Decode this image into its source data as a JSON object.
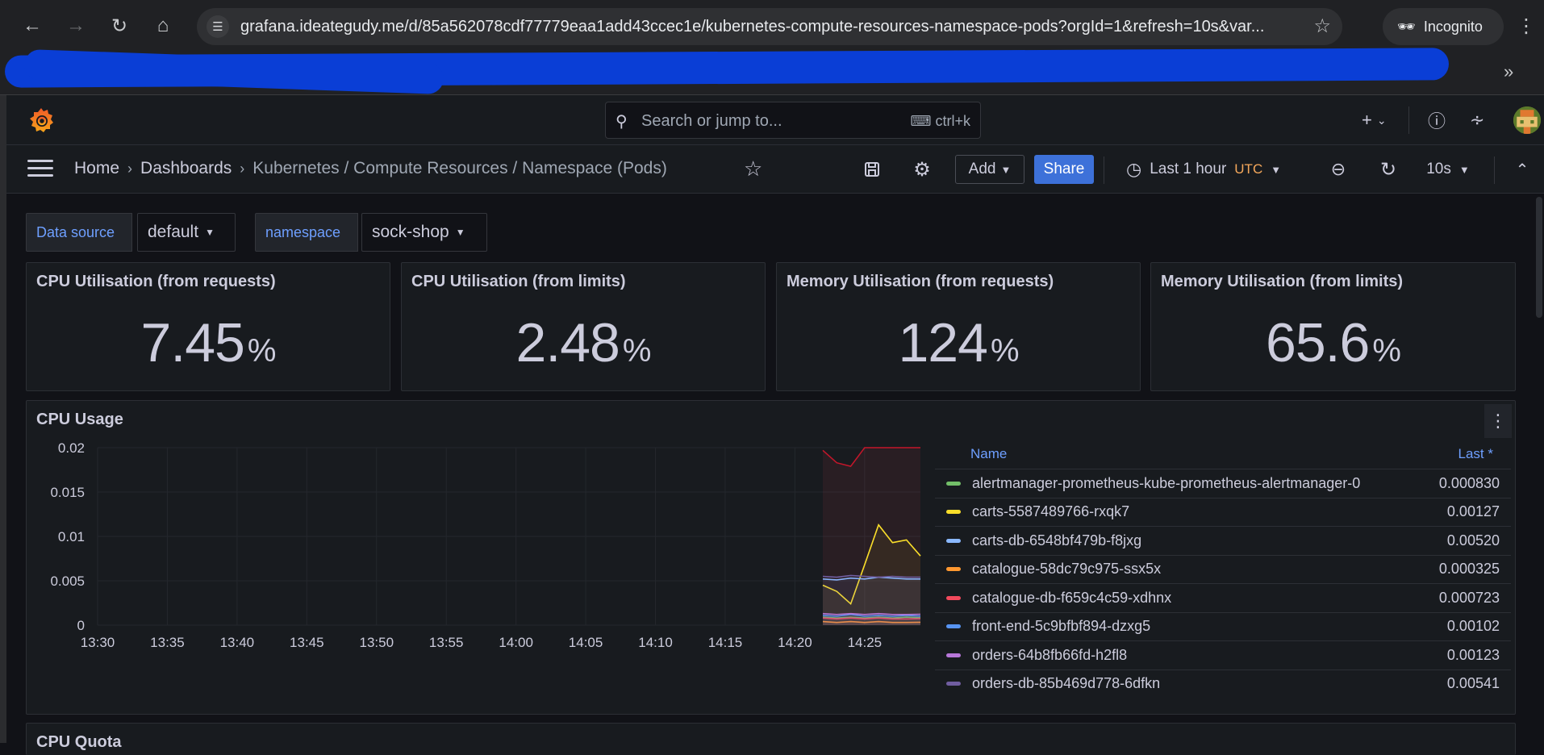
{
  "browser": {
    "url": "grafana.ideategudy.me/d/85a562078cdf77779eaa1add43ccec1e/kubernetes-compute-resources-namespace-pods?orgId=1&refresh=10s&var...",
    "incognito_label": "Incognito"
  },
  "topbar": {
    "search_placeholder": "Search or jump to...",
    "search_shortcut": "ctrl+k"
  },
  "breadcrumb": {
    "home": "Home",
    "dashboards": "Dashboards",
    "current": "Kubernetes / Compute Resources / Namespace (Pods)"
  },
  "toolbar": {
    "add_label": "Add",
    "share_label": "Share",
    "time_range": "Last 1 hour",
    "timezone": "UTC",
    "refresh_interval": "10s"
  },
  "variables": {
    "datasource_label": "Data source",
    "datasource_value": "default",
    "namespace_label": "namespace",
    "namespace_value": "sock-shop"
  },
  "stats": [
    {
      "title": "CPU Utilisation (from requests)",
      "value": "7.45",
      "unit": "%"
    },
    {
      "title": "CPU Utilisation (from limits)",
      "value": "2.48",
      "unit": "%"
    },
    {
      "title": "Memory Utilisation (from requests)",
      "value": "124",
      "unit": "%"
    },
    {
      "title": "Memory Utilisation (from limits)",
      "value": "65.6",
      "unit": "%"
    }
  ],
  "cpu_panel": {
    "title": "CPU Usage",
    "legend_name_header": "Name",
    "legend_last_header": "Last *"
  },
  "next_panel_title": "CPU Quota",
  "colors": {
    "accent": "#3d71d9",
    "link": "#6e9fff",
    "utc": "#f5a85b"
  },
  "chart_data": {
    "type": "line",
    "title": "CPU Usage",
    "xlabel": "",
    "ylabel": "",
    "y_ticks": [
      "0.02",
      "0.015",
      "0.01",
      "0.005",
      "0"
    ],
    "x_ticks": [
      "13:30",
      "13:35",
      "13:40",
      "13:45",
      "13:50",
      "13:55",
      "14:00",
      "14:05",
      "14:10",
      "14:15",
      "14:20",
      "14:25"
    ],
    "ylim": [
      0,
      0.02
    ],
    "xlim": [
      "13:30",
      "14:29"
    ],
    "grid": true,
    "legend_position": "right",
    "x": [
      "14:22",
      "14:23",
      "14:24",
      "14:25",
      "14:26",
      "14:27",
      "14:28",
      "14:29"
    ],
    "series": [
      {
        "name": "alertmanager-prometheus-kube-prometheus-alertmanager-0",
        "color": "#73bf69",
        "last": "0.000830",
        "values": [
          0.0009,
          0.0008,
          0.0009,
          0.0008,
          0.0009,
          0.0008,
          0.0009,
          0.00083
        ]
      },
      {
        "name": "carts-5587489766-rxqk7",
        "color": "#fade2a",
        "last": "0.00127",
        "values": [
          0.0045,
          0.0038,
          0.0024,
          0.0068,
          0.0113,
          0.0093,
          0.0096,
          0.0078
        ]
      },
      {
        "name": "carts-db-6548bf479b-f8jxg",
        "color": "#8ab8ff",
        "last": "0.00520",
        "values": [
          0.0052,
          0.0051,
          0.0053,
          0.0052,
          0.0054,
          0.0053,
          0.0052,
          0.0052
        ]
      },
      {
        "name": "catalogue-58dc79c975-ssx5x",
        "color": "#ff9830",
        "last": "0.000325",
        "values": [
          0.0004,
          0.0003,
          0.0004,
          0.0003,
          0.0004,
          0.0003,
          0.0003,
          0.000325
        ]
      },
      {
        "name": "catalogue-db-f659c4c59-xdhnx",
        "color": "#f2495c",
        "last": "0.000723",
        "values": [
          0.0008,
          0.0007,
          0.0008,
          0.0007,
          0.0008,
          0.0007,
          0.0007,
          0.000723
        ]
      },
      {
        "name": "front-end-5c9bfbf894-dzxg5",
        "color": "#5794f2",
        "last": "0.00102",
        "values": [
          0.0011,
          0.001,
          0.0012,
          0.001,
          0.0011,
          0.001,
          0.0011,
          0.00102
        ]
      },
      {
        "name": "orders-64b8fb66fd-h2fl8",
        "color": "#b877d9",
        "last": "0.00123",
        "values": [
          0.0013,
          0.0012,
          0.0013,
          0.0012,
          0.0013,
          0.0012,
          0.0012,
          0.00123
        ]
      },
      {
        "name": "orders-db-85b469d778-6dfkn",
        "color": "#705da0",
        "last": "0.00541",
        "values": [
          0.0055,
          0.0054,
          0.0056,
          0.0055,
          0.0054,
          0.0055,
          0.0054,
          0.00541
        ]
      }
    ]
  }
}
